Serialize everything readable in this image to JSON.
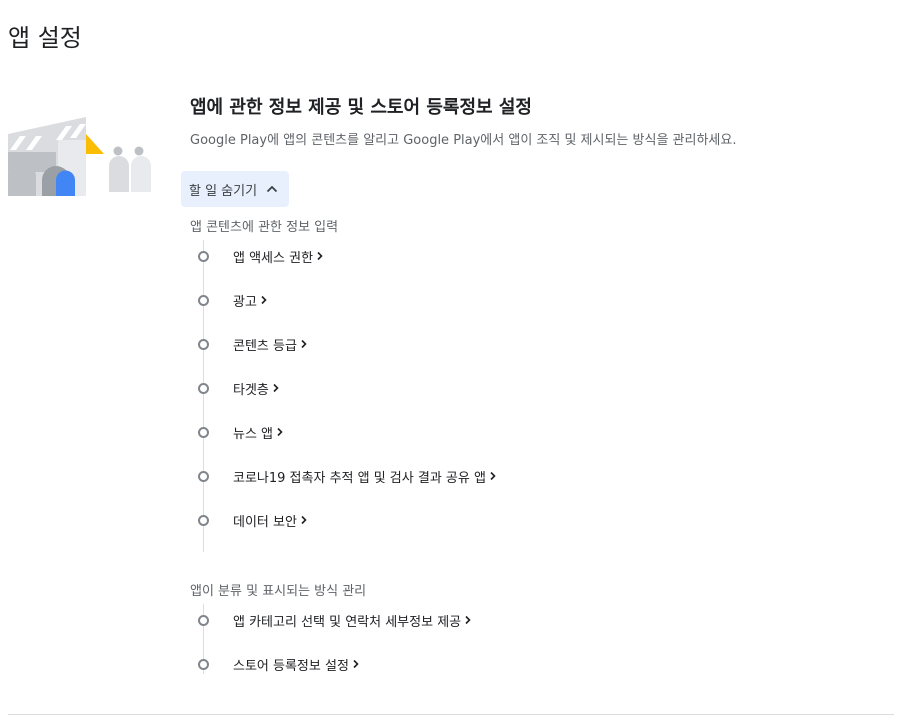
{
  "page": {
    "title": "앱 설정"
  },
  "section": {
    "title": "앱에 관한 정보 제공 및 스토어 등록정보 설정",
    "description": "Google Play에 앱의 콘텐츠를 알리고 Google Play에서 앱이 조직 및 제시되는 방식을 관리하세요.",
    "toggle_label": "할 일 숨기기"
  },
  "groups": [
    {
      "label": "앱 콘텐츠에 관한 정보 입력",
      "tasks": [
        {
          "label": "앱 액세스 권한"
        },
        {
          "label": "광고"
        },
        {
          "label": "콘텐츠 등급"
        },
        {
          "label": "타겟층"
        },
        {
          "label": "뉴스 앱"
        },
        {
          "label": "코로나19 접촉자 추적 앱 및 검사 결과 공유 앱"
        },
        {
          "label": "데이터 보안"
        }
      ]
    },
    {
      "label": "앱이 분류 및 표시되는 방식 관리",
      "tasks": [
        {
          "label": "앱 카테고리 선택 및 연락처 세부정보 제공"
        },
        {
          "label": "스토어 등록정보 설정"
        }
      ]
    }
  ],
  "icons": {
    "toggle": "chevron-up-icon",
    "task": "chevron-right-icon"
  },
  "colors": {
    "toggle_background": "#e8f0fe",
    "illustration_blue": "#4285f4",
    "illustration_yellow": "#fbbc04",
    "illustration_gray": "#bdc1c6"
  }
}
